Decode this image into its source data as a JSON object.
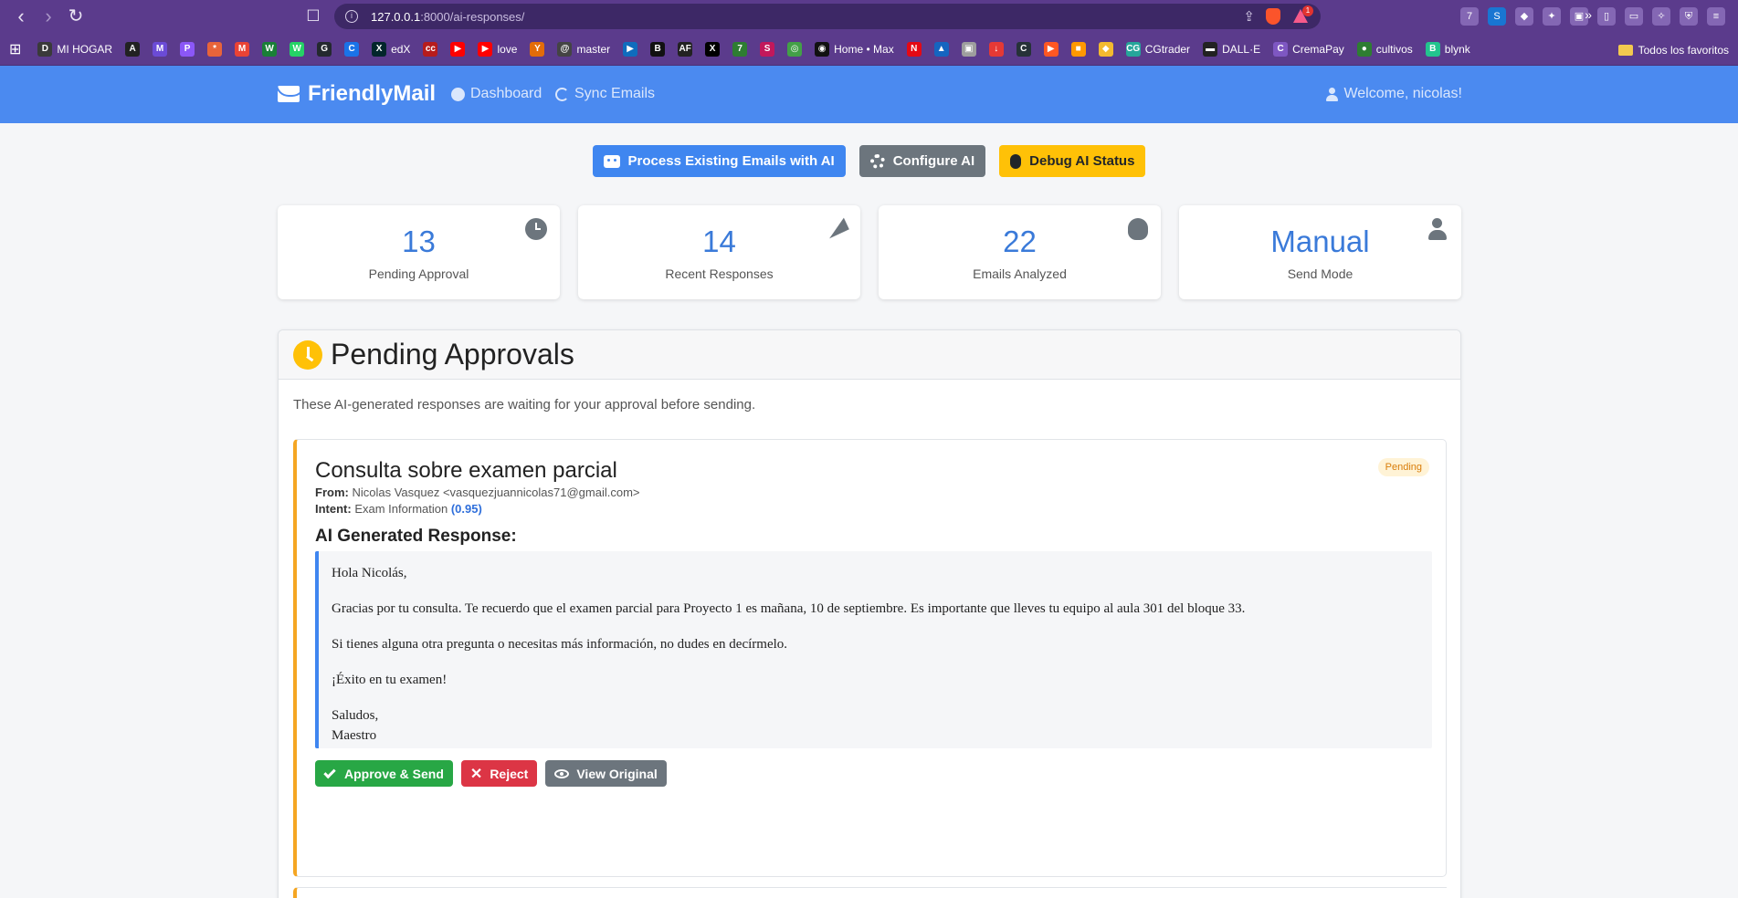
{
  "browser": {
    "url_host": "127.0.0.1",
    "url_path": ":8000/ai-responses/",
    "brave_badge": "1",
    "ext_badge": "7",
    "bookmarks": [
      {
        "label": "MI HOGAR",
        "color": "#3a3a3a",
        "glyph": "D"
      },
      {
        "label": "",
        "color": "#222222",
        "glyph": "A"
      },
      {
        "label": "",
        "color": "#6b4bd6",
        "glyph": "M"
      },
      {
        "label": "",
        "color": "#8b57f7",
        "glyph": "P"
      },
      {
        "label": "",
        "color": "#e8643a",
        "glyph": "*"
      },
      {
        "label": "",
        "color": "#ea4335",
        "glyph": "M"
      },
      {
        "label": "",
        "color": "#1a7f37",
        "glyph": "W"
      },
      {
        "label": "",
        "color": "#25d366",
        "glyph": "W"
      },
      {
        "label": "",
        "color": "#24292f",
        "glyph": "G"
      },
      {
        "label": "",
        "color": "#1a73e8",
        "glyph": "C"
      },
      {
        "label": "edX",
        "color": "#02262b",
        "glyph": "X"
      },
      {
        "label": "",
        "color": "#b71c1c",
        "glyph": "cc"
      },
      {
        "label": "",
        "color": "#ff0000",
        "glyph": "▶"
      },
      {
        "label": "love",
        "color": "#ff0000",
        "glyph": "▶"
      },
      {
        "label": "",
        "color": "#e36c09",
        "glyph": "Y"
      },
      {
        "label": "master",
        "color": "#444444",
        "glyph": "@"
      },
      {
        "label": "",
        "color": "#0f6cbd",
        "glyph": "▶"
      },
      {
        "label": "",
        "color": "#111111",
        "glyph": "B"
      },
      {
        "label": "",
        "color": "#222222",
        "glyph": "AF"
      },
      {
        "label": "",
        "color": "#000000",
        "glyph": "X"
      },
      {
        "label": "",
        "color": "#2e7d32",
        "glyph": "7"
      },
      {
        "label": "",
        "color": "#c2185b",
        "glyph": "S"
      },
      {
        "label": "",
        "color": "#43a047",
        "glyph": "◎"
      },
      {
        "label": "Home • Max",
        "color": "#111111",
        "glyph": "◉"
      },
      {
        "label": "",
        "color": "#e50914",
        "glyph": "N"
      },
      {
        "label": "",
        "color": "#1565c0",
        "glyph": "▲"
      },
      {
        "label": "",
        "color": "#9e9e9e",
        "glyph": "▣"
      },
      {
        "label": "",
        "color": "#e53935",
        "glyph": "↓"
      },
      {
        "label": "",
        "color": "#263238",
        "glyph": "C"
      },
      {
        "label": "",
        "color": "#ff5722",
        "glyph": "▶"
      },
      {
        "label": "",
        "color": "#ff9800",
        "glyph": "■"
      },
      {
        "label": "",
        "color": "#f3ba2f",
        "glyph": "◆"
      },
      {
        "label": "CGtrader",
        "color": "#26a69a",
        "glyph": "CG"
      },
      {
        "label": "DALL·E",
        "color": "#222222",
        "glyph": "▬"
      },
      {
        "label": "CremaPay",
        "color": "#7e57c2",
        "glyph": "C"
      },
      {
        "label": "cultivos",
        "color": "#2e7d32",
        "glyph": "●"
      },
      {
        "label": "blynk",
        "color": "#23c48e",
        "glyph": "B"
      }
    ],
    "bookmarks_folder": "Todos los favoritos"
  },
  "navbar": {
    "brand": "FriendlyMail",
    "dashboard": "Dashboard",
    "sync": "Sync Emails",
    "user": "Welcome, nicolas!"
  },
  "actions": {
    "process": "Process Existing Emails with AI",
    "configure": "Configure AI",
    "debug": "Debug AI Status"
  },
  "stats": [
    {
      "value": "13",
      "label": "Pending Approval",
      "icon": "clock-icon"
    },
    {
      "value": "14",
      "label": "Recent Responses",
      "icon": "paper-plane-icon"
    },
    {
      "value": "22",
      "label": "Emails Analyzed",
      "icon": "brain-icon"
    },
    {
      "value": "Manual",
      "label": "Send Mode",
      "icon": "user-icon"
    }
  ],
  "pending": {
    "title": "Pending Approvals",
    "description": "These AI-generated responses are waiting for your approval before sending.",
    "email": {
      "subject": "Consulta sobre examen parcial",
      "status": "Pending",
      "from_label": "From:",
      "from_value": "Nicolas Vasquez <vasquezjuannicolas71@gmail.com>",
      "intent_label": "Intent:",
      "intent_value": "Exam Information",
      "confidence": "(0.95)",
      "ai_heading": "AI Generated Response:",
      "response": {
        "greeting": "Hola Nicolás,",
        "p1": "Gracias por tu consulta. Te recuerdo que el examen parcial para Proyecto 1 es mañana, 10 de septiembre. Es importante que lleves tu equipo al aula 301 del bloque 33.",
        "p2": "Si tienes alguna otra pregunta o necesitas más información, no dudes en decírmelo.",
        "p3": "¡Éxito en tu examen!",
        "closing": "Saludos,",
        "signature": "Maestro"
      },
      "approve": "Approve & Send",
      "reject": "Reject",
      "view": "View Original"
    }
  },
  "colors": {
    "chrome": "#5b3b8c",
    "navbar": "#4b8af0",
    "primary": "#3f86f0",
    "warning": "#ffc107",
    "success": "#28a745",
    "danger": "#dc3545"
  }
}
